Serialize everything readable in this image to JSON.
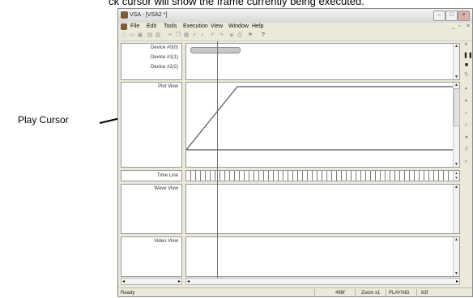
{
  "caption": "ck cursor will show the frame currently being executed.",
  "annotation": {
    "label": "Play Cursor"
  },
  "window": {
    "title": "VSA - [VSA2 *]",
    "menu": [
      "File",
      "Edit",
      "Tools",
      "Execution",
      "View",
      "Window",
      "Help"
    ],
    "device_labels": [
      "Device #0(0)",
      "Device #1(1)",
      "Device #2(2)"
    ],
    "pane_labels": {
      "plot": "Plot View",
      "timeline": "Time Line",
      "wave": "Wave View",
      "video": "Video View"
    },
    "status": {
      "ready": "Ready",
      "frames": "498f",
      "zoom": "Zoom x1",
      "state": "PLAYING",
      "current": "63f"
    }
  },
  "icons": [
    "app-icon",
    "new-icon",
    "open-icon",
    "save-icon",
    "cut-icon",
    "copy-icon",
    "paste-icon",
    "delete-icon",
    "undo-icon",
    "redo-icon",
    "print-icon",
    "help-icon"
  ],
  "colors": {
    "chrome": "#ece9d8",
    "cursor": "#6f6f6f",
    "plot_line": "#555555"
  }
}
